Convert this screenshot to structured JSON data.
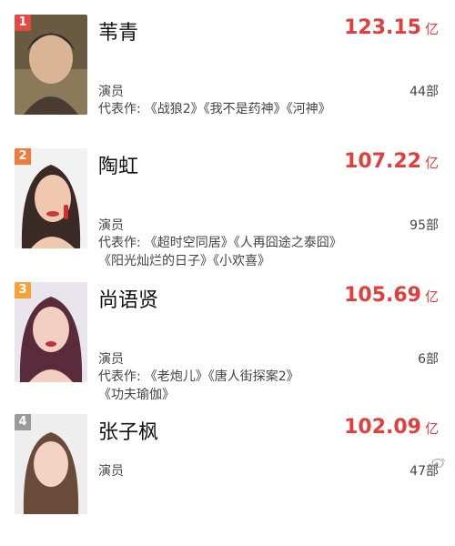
{
  "entries": [
    {
      "rank": "1",
      "rank_color": "#e24a44",
      "name": "苇青",
      "score": "123.15",
      "unit": "亿",
      "role": "演员",
      "count": "44部",
      "works_label": "代表作:",
      "works_line1": "《战狼2》《我不是药神》《河神》",
      "works_line2": ""
    },
    {
      "rank": "2",
      "rank_color": "#f07a3a",
      "name": "陶虹",
      "score": "107.22",
      "unit": "亿",
      "role": "演员",
      "count": "95部",
      "works_label": "代表作:",
      "works_line1": "《超时空同居》《人再囧途之泰囧》",
      "works_line2": "《阳光灿烂的日子》《小欢喜》"
    },
    {
      "rank": "3",
      "rank_color": "#f3a33a",
      "name": "尚语贤",
      "score": "105.69",
      "unit": "亿",
      "role": "演员",
      "count": "6部",
      "works_label": "代表作:",
      "works_line1": "《老炮儿》《唐人街探案2》",
      "works_line2": "《功夫瑜伽》"
    },
    {
      "rank": "4",
      "rank_color": "#9a9a9a",
      "name": "张子枫",
      "score": "102.09",
      "unit": "亿",
      "role": "演员",
      "count": "47部",
      "works_label": "",
      "works_line1": "",
      "works_line2": ""
    }
  ]
}
